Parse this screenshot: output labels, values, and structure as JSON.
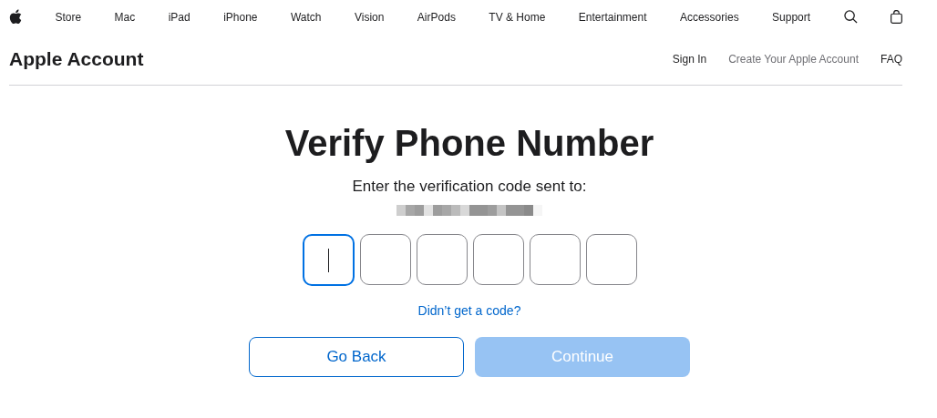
{
  "nav": {
    "items": [
      "Store",
      "Mac",
      "iPad",
      "iPhone",
      "Watch",
      "Vision",
      "AirPods",
      "TV & Home",
      "Entertainment",
      "Accessories",
      "Support"
    ]
  },
  "header": {
    "title": "Apple Account",
    "links": [
      {
        "label": "Sign In",
        "dimmed": false
      },
      {
        "label": "Create Your Apple Account",
        "dimmed": true
      },
      {
        "label": "FAQ",
        "dimmed": false
      }
    ]
  },
  "page": {
    "heading": "Verify Phone Number",
    "subtitle": "Enter the verification code sent to:",
    "code_fields": [
      {
        "focused": true
      },
      {
        "focused": false
      },
      {
        "focused": false
      },
      {
        "focused": false
      },
      {
        "focused": false
      },
      {
        "focused": false
      }
    ],
    "resend_link": "Didn’t get a code?",
    "buttons": [
      {
        "label": "Go Back",
        "kind": "secondary",
        "disabled": false
      },
      {
        "label": "Continue",
        "kind": "primary",
        "disabled": true
      }
    ]
  }
}
